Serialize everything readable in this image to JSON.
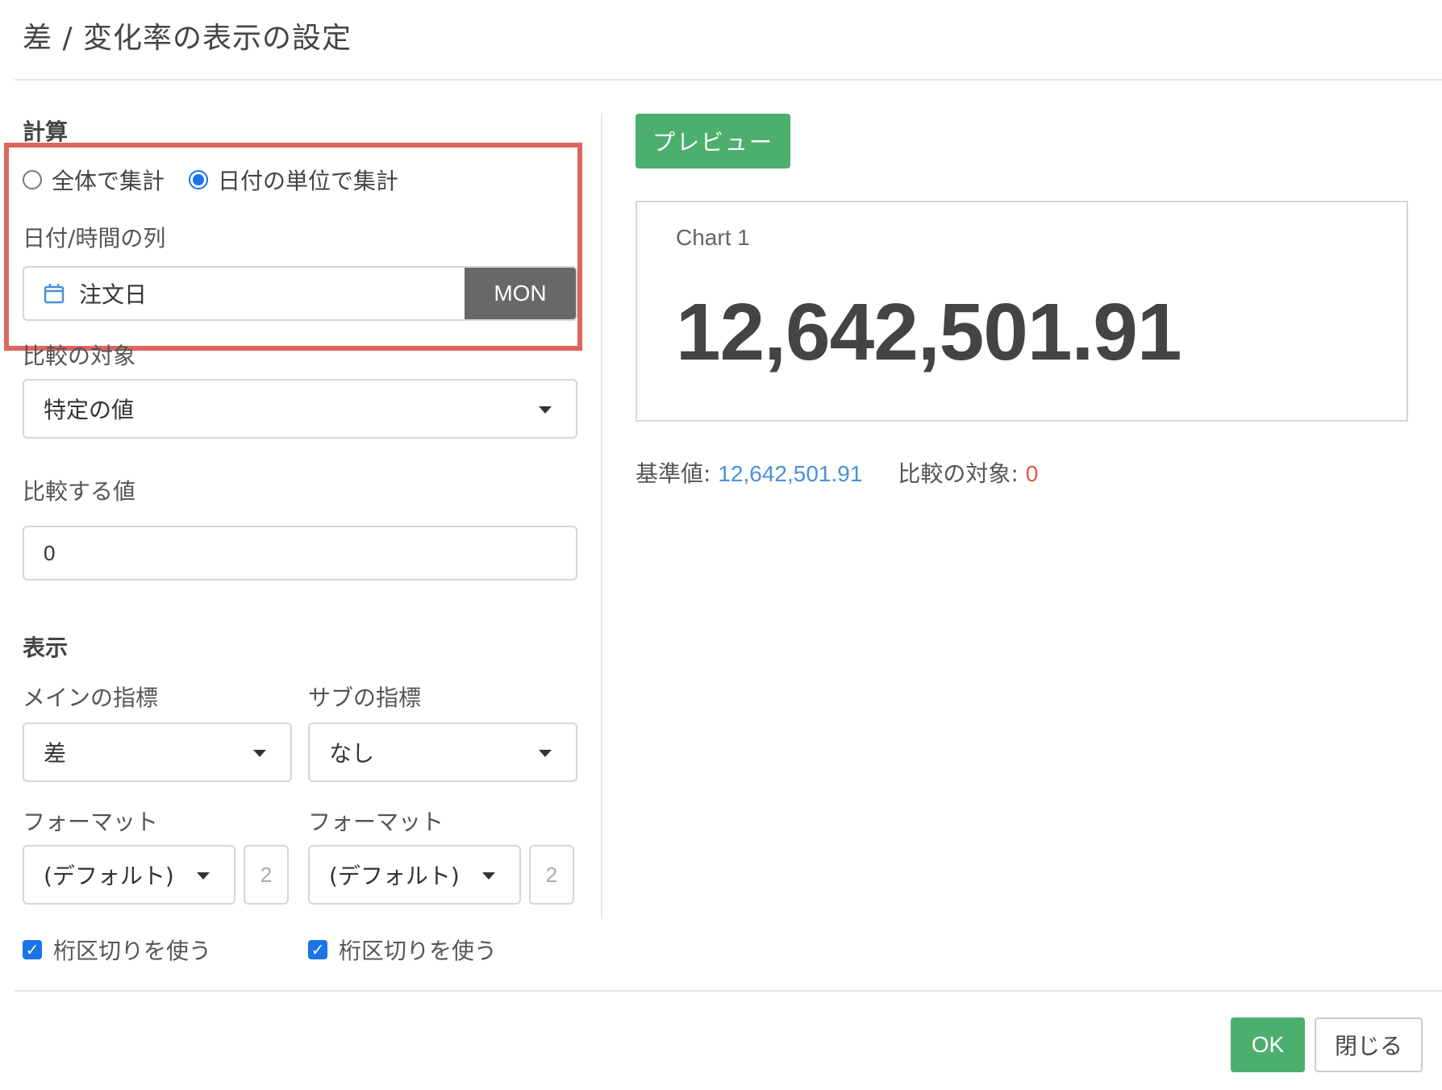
{
  "dialog": {
    "title": "差 / 変化率の表示の設定"
  },
  "calculation": {
    "section_label": "計算",
    "radio_options": [
      "全体で集計",
      "日付の単位で集計"
    ],
    "selected_option": "日付の単位で集計",
    "date_column_label": "日付/時間の列",
    "date_column_value": "注文日",
    "date_unit": "MON"
  },
  "comparison": {
    "target_label": "比較の対象",
    "target_value": "特定の値",
    "value_label": "比較する値",
    "value": "0"
  },
  "display": {
    "section_label": "表示",
    "main_metric_label": "メインの指標",
    "main_metric_value": "差",
    "sub_metric_label": "サブの指標",
    "sub_metric_value": "なし",
    "format_label_main": "フォーマット",
    "format_label_sub": "フォーマット",
    "format_main_value": "(デフォルト)",
    "format_sub_value": "(デフォルト)",
    "decimals_main": "2",
    "decimals_sub": "2",
    "separator_main_label": "桁区切りを使う",
    "separator_sub_label": "桁区切りを使う",
    "separator_main_checked": true,
    "separator_sub_checked": true
  },
  "preview": {
    "button_label": "プレビュー",
    "chart_title": "Chart 1",
    "chart_value": "12,642,501.91",
    "base_label": "基準値:",
    "base_value": "12,642,501.91",
    "compare_label": "比較の対象:",
    "compare_value": "0"
  },
  "footer": {
    "ok_label": "OK",
    "close_label": "閉じる"
  },
  "colors": {
    "accent_green": "#4caf6e",
    "highlight_red": "#dd6660",
    "link_blue": "#4a90d9",
    "value_red": "#e05545",
    "unit_gray": "#686868"
  },
  "icons": {
    "date_column": "calendar-icon"
  }
}
